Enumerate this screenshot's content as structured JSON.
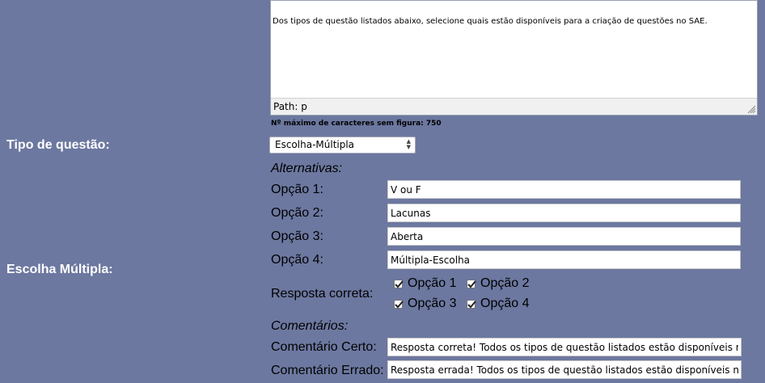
{
  "editor": {
    "content": "Dos tipos de questão listados abaixo, selecione quais estão disponíveis para a criação de questões no SAE.",
    "path": "Path: p"
  },
  "char_limit": "Nº máximo de caracteres sem figura: 750",
  "labels": {
    "question_type": "Tipo de questão:",
    "multiple_choice": "Escolha Múltipla:"
  },
  "question_type_select": {
    "selected": "Escolha-Múltipla"
  },
  "alternatives": {
    "title": "Alternativas:",
    "options": [
      {
        "label": "Opção 1:",
        "value": "V ou F"
      },
      {
        "label": "Opção 2:",
        "value": "Lacunas"
      },
      {
        "label": "Opção 3:",
        "value": "Aberta"
      },
      {
        "label": "Opção 4:",
        "value": "Múltipla-Escolha"
      }
    ]
  },
  "correct_answer": {
    "label": "Resposta correta:",
    "checkboxes": [
      {
        "label": "Opção 1",
        "checked": true
      },
      {
        "label": "Opção 2",
        "checked": true
      },
      {
        "label": "Opção 3",
        "checked": true
      },
      {
        "label": "Opção 4",
        "checked": true
      }
    ]
  },
  "comments": {
    "title": "Comentários:",
    "correct_label": "Comentário Certo:",
    "correct_value": "Resposta correta! Todos os tipos de questão listados estão disponíveis no SAE!",
    "wrong_label": "Comentário Errado:",
    "wrong_value": "Resposta errada! Todos os tipos de questão listados estão disponíveis no SAE!"
  },
  "colors": {
    "background": "#6c78a0"
  }
}
